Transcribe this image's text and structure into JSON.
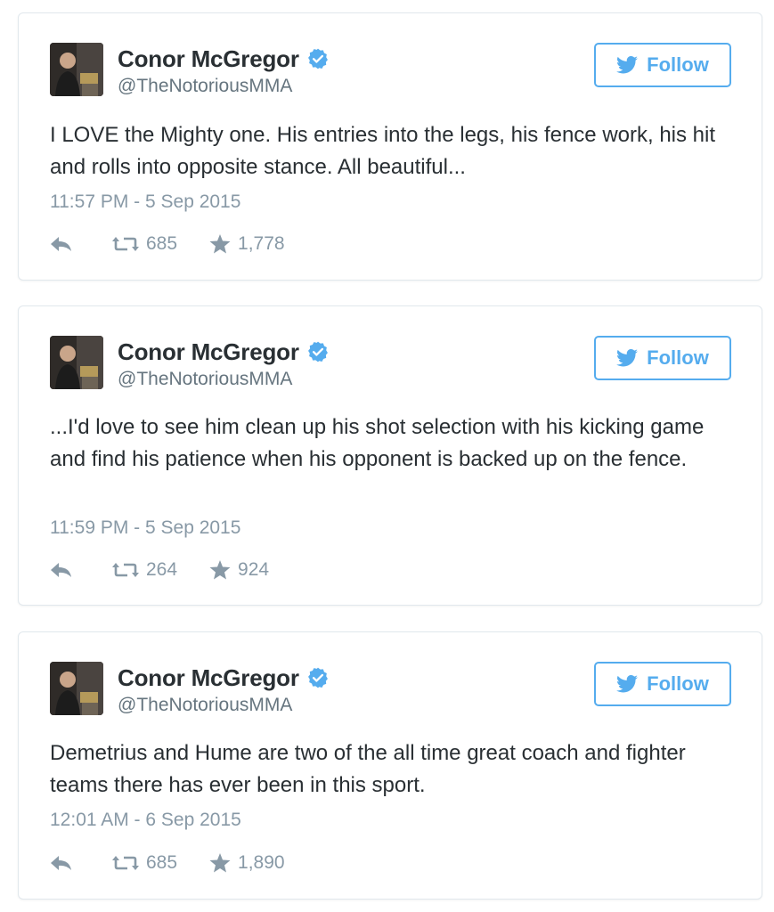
{
  "colors": {
    "twitter_blue": "#55acee",
    "text": "#292f33",
    "muted": "#8899a6",
    "border": "#e1e8ed"
  },
  "tweets": [
    {
      "author": {
        "name": "Conor McGregor",
        "handle": "@TheNotoriousMMA",
        "verified": true,
        "avatar": "avatar-photo"
      },
      "follow_label": "Follow",
      "text": "I LOVE the Mighty one. His entries into the legs, his fence work, his hit and rolls into opposite stance. All beautiful...",
      "timestamp": "11:57 PM - 5 Sep 2015",
      "retweets": "685",
      "likes": "1,778",
      "icons": {
        "reply": "reply-icon",
        "retweet": "retweet-icon",
        "like": "star-icon",
        "follow": "twitter-bird-icon",
        "verified": "verified-badge-icon"
      }
    },
    {
      "author": {
        "name": "Conor McGregor",
        "handle": "@TheNotoriousMMA",
        "verified": true,
        "avatar": "avatar-photo"
      },
      "follow_label": "Follow",
      "text": "...I'd love to see him clean up his shot selection with his kicking game and find his patience when his opponent is backed up on the fence.",
      "timestamp": "11:59 PM - 5 Sep 2015",
      "retweets": "264",
      "likes": "924",
      "icons": {
        "reply": "reply-icon",
        "retweet": "retweet-icon",
        "like": "star-icon",
        "follow": "twitter-bird-icon",
        "verified": "verified-badge-icon"
      }
    },
    {
      "author": {
        "name": "Conor McGregor",
        "handle": "@TheNotoriousMMA",
        "verified": true,
        "avatar": "avatar-photo"
      },
      "follow_label": "Follow",
      "text": "Demetrius and Hume are two of the all time great coach and fighter teams there has ever been in this sport.",
      "timestamp": "12:01 AM - 6 Sep 2015",
      "retweets": "685",
      "likes": "1,890",
      "icons": {
        "reply": "reply-icon",
        "retweet": "retweet-icon",
        "like": "star-icon",
        "follow": "twitter-bird-icon",
        "verified": "verified-badge-icon"
      }
    }
  ]
}
